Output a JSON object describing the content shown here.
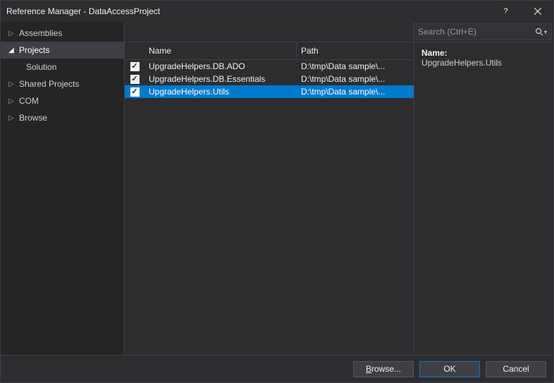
{
  "window": {
    "title": "Reference Manager - DataAccessProject"
  },
  "sidebar": {
    "items": [
      {
        "label": "Assemblies",
        "expanded": false,
        "selected": false
      },
      {
        "label": "Projects",
        "expanded": true,
        "selected": true,
        "children": [
          {
            "label": "Solution"
          }
        ]
      },
      {
        "label": "Shared Projects",
        "expanded": false,
        "selected": false
      },
      {
        "label": "COM",
        "expanded": false,
        "selected": false
      },
      {
        "label": "Browse",
        "expanded": false,
        "selected": false
      }
    ]
  },
  "search": {
    "placeholder": "Search (Ctrl+E)"
  },
  "columns": {
    "name": "Name",
    "path": "Path"
  },
  "rows": [
    {
      "checked": true,
      "selected": false,
      "name": "UpgradeHelpers.DB.ADO",
      "path": "D:\\tmp\\Data sample\\..."
    },
    {
      "checked": true,
      "selected": false,
      "name": "UpgradeHelpers.DB.Essentials",
      "path": "D:\\tmp\\Data sample\\..."
    },
    {
      "checked": true,
      "selected": true,
      "name": "UpgradeHelpers.Utils",
      "path": "D:\\tmp\\Data sample\\..."
    }
  ],
  "details": {
    "name_label": "Name:",
    "name_value": "UpgradeHelpers.Utils"
  },
  "footer": {
    "browse": "Browse...",
    "ok": "OK",
    "cancel": "Cancel"
  }
}
